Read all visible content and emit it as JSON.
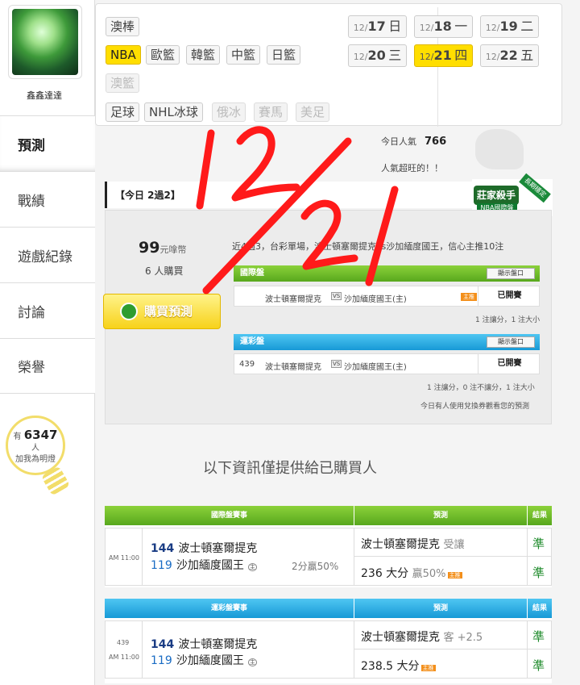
{
  "user": {
    "name": "鑫鑫達達"
  },
  "sidebar": {
    "items": [
      {
        "label": "預測"
      },
      {
        "label": "戰績"
      },
      {
        "label": "遊戲紀錄"
      },
      {
        "label": "討論"
      },
      {
        "label": "榮譽"
      }
    ],
    "bulb": {
      "prefix": "有",
      "count": "6347",
      "suffix": "人",
      "caption": "加我為明燈"
    }
  },
  "categories": {
    "row1": [
      "澳棒"
    ],
    "row2": [
      "NBA",
      "歐籃",
      "韓籃",
      "中籃",
      "日籃"
    ],
    "row3": [
      "澳籃"
    ],
    "row4": [
      "足球",
      "NHL冰球",
      "俄冰",
      "賽馬",
      "美足"
    ],
    "selected": "NBA"
  },
  "dates": [
    {
      "md": "12/",
      "d": "17",
      "wk": "日"
    },
    {
      "md": "12/",
      "d": "18",
      "wk": "一"
    },
    {
      "md": "12/",
      "d": "19",
      "wk": "二"
    },
    {
      "md": "12/",
      "d": "20",
      "wk": "三"
    },
    {
      "md": "12/",
      "d": "21",
      "wk": "四"
    },
    {
      "md": "12/",
      "d": "22",
      "wk": "五"
    }
  ],
  "popularity": {
    "label": "今日人氣",
    "value": "766",
    "note": "人氣超旺的！！"
  },
  "badge": {
    "title": "莊家殺手",
    "sub": "NBA國際盤",
    "ribbon": "長期穩定"
  },
  "today": {
    "heading": "【今日 2過2】",
    "price": "99",
    "price_unit": "元嗱幣",
    "buyers": "6 人購買",
    "buy_button": "購買預測",
    "intro": "近4過3，台彩單場，波士頓塞爾提克vs沙加緬度國王，信心主推10注",
    "intl": {
      "title": "國際盤",
      "show_label": "顯示盤口",
      "home": "波士頓塞爾提克",
      "vs": "VS",
      "away": "沙加緬度國王(主)",
      "tag": "主推",
      "status": "已開賽",
      "note": "1 注讓分，1 注大小"
    },
    "sport": {
      "title": "運彩盤",
      "show_label": "顯示盤口",
      "no": "439",
      "home": "波士頓塞爾提克",
      "vs": "VS",
      "away": "沙加緬度國王(主)",
      "status": "已開賽",
      "note": "1 注讓分，0 注不讓分，1 注大小",
      "footnote": "今日有人使用兌換券觀看您的預測"
    }
  },
  "info_title": "以下資訊僅提供給已購買人",
  "table_intl": {
    "header": "國際盤賽事",
    "pred_header": "預測",
    "result_header": "結果",
    "time": "AM 11:00",
    "team1_no": "144",
    "team1": "波士頓塞爾提克",
    "team2_no": "119",
    "team2": "沙加緬度國王",
    "home_mark": "主",
    "line": "2分贏50%",
    "pred1": "波士頓塞爾提克",
    "pred1_note": "受讓",
    "pred2": "236 大分",
    "pred2_note": "贏50%",
    "tag": "主推",
    "res1": "準",
    "res2": "準"
  },
  "table_sport": {
    "header": "運彩盤賽事",
    "pred_header": "預測",
    "result_header": "結果",
    "no": "439",
    "time": "AM 11:00",
    "team1_no": "144",
    "team1": "波士頓塞爾提克",
    "team2_no": "119",
    "team2": "沙加緬度國王",
    "home_mark": "主",
    "pred1": "波士頓塞爾提克",
    "pred1_note": "客 +2.5",
    "pred2": "238.5 大分",
    "tag": "主推",
    "res1": "準",
    "res2": "準"
  },
  "colors": {
    "accent_yellow": "#ffde00",
    "green": "#58a81d",
    "blue": "#1799d6",
    "ink": "#ff0000"
  },
  "annotation": "12/21"
}
